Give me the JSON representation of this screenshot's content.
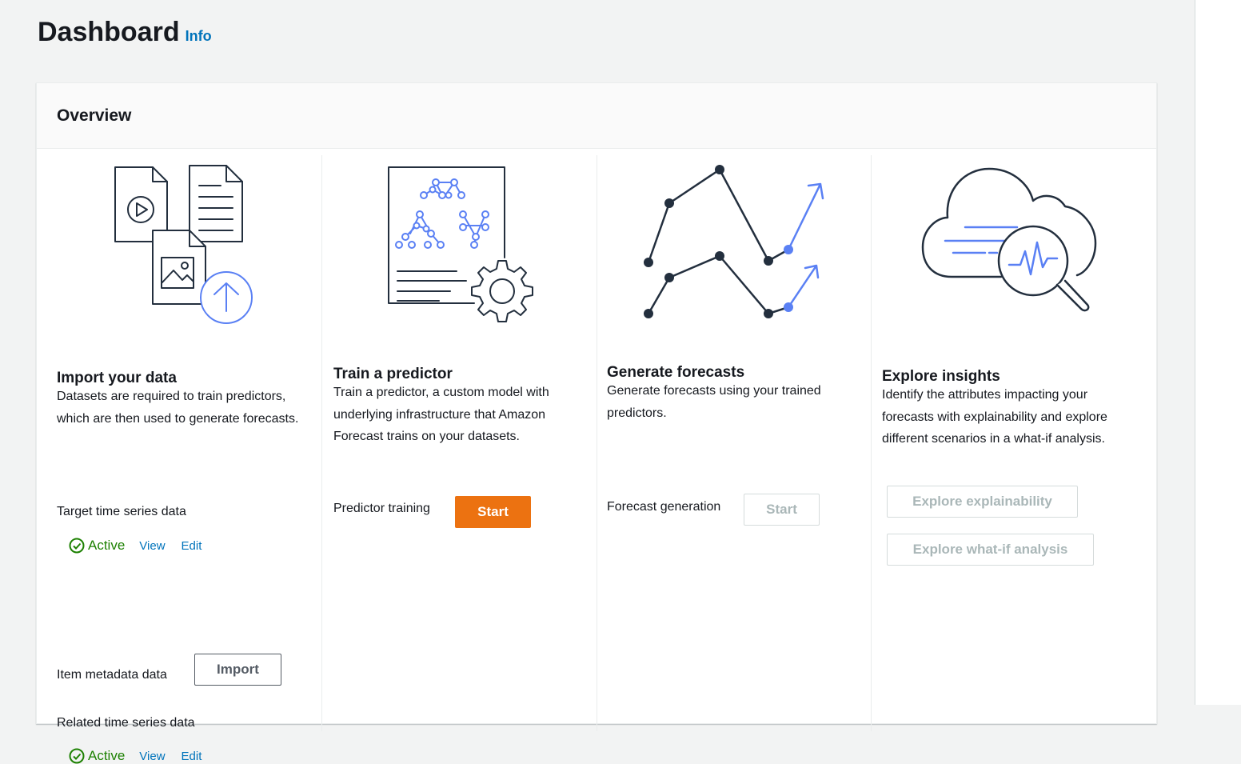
{
  "page": {
    "title": "Dashboard",
    "info_link": "Info"
  },
  "overview": {
    "title": "Overview",
    "import": {
      "title": "Import your data",
      "description": "Datasets are required to train predictors, which are then used to generate forecasts.",
      "rows": [
        {
          "label": "Target time series data",
          "status": "Active",
          "view": "View",
          "edit": "Edit"
        },
        {
          "label": "Item metadata data",
          "button": "Import"
        },
        {
          "label": "Related time series data",
          "status": "Active",
          "view": "View",
          "edit": "Edit"
        }
      ]
    },
    "train": {
      "title": "Train a predictor",
      "description": "Train a predictor, a custom model with underlying infrastructure that Amazon Forecast trains on your datasets.",
      "row_label": "Predictor training",
      "button": "Start"
    },
    "generate": {
      "title": "Generate forecasts",
      "description": "Generate forecasts using your trained predictors.",
      "row_label": "Forecast generation",
      "button": "Start"
    },
    "insights": {
      "title": "Explore insights",
      "description": "Identify the attributes impacting your forecasts with explainability and explore different scenarios in a what-if analysis.",
      "button_explainability": "Explore explainability",
      "button_whatif": "Explore what-if analysis"
    }
  },
  "colors": {
    "primary": "#ec7211",
    "link": "#0073bb",
    "success": "#1d8102",
    "illustration_accent": "#5a80f4",
    "illustration_line": "#232f3e"
  },
  "icons": [
    "documents-upload-illustration",
    "predictor-gear-illustration",
    "forecast-lines-illustration",
    "cloud-insights-illustration",
    "success-check-icon"
  ]
}
